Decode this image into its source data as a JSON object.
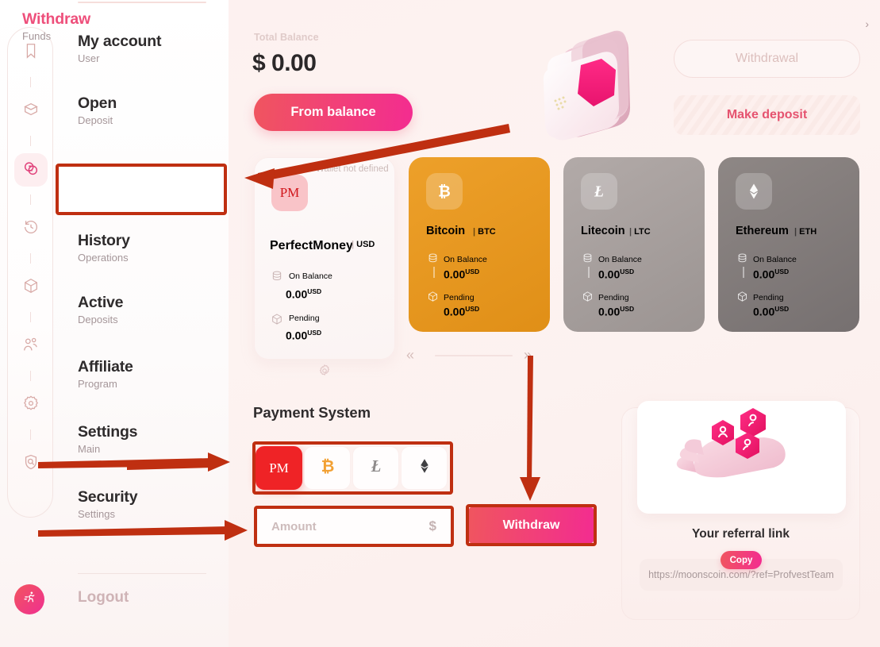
{
  "brand": {
    "accent": "#ee4f7b",
    "accent2": "#f32c90",
    "annotation": "#bf2f11"
  },
  "sidebar": {
    "items": [
      {
        "title": "My account",
        "sub": "User",
        "icon": "bookmark-icon"
      },
      {
        "title": "Open",
        "sub": "Deposit",
        "icon": "open-box-icon"
      },
      {
        "title": "Withdraw",
        "sub": "Funds",
        "icon": "exchange-icon",
        "chevron": "›"
      },
      {
        "title": "History",
        "sub": "Operations",
        "icon": "clock-history-icon"
      },
      {
        "title": "Active",
        "sub": "Deposits",
        "icon": "cube-icon"
      },
      {
        "title": "Affiliate",
        "sub": "Program",
        "icon": "users-icon"
      },
      {
        "title": "Settings",
        "sub": "Main",
        "icon": "gear-icon"
      },
      {
        "title": "Security",
        "sub": "Settings",
        "icon": "shield-search-icon"
      }
    ],
    "logout_label": "Logout",
    "logout_icon": "running-person-icon"
  },
  "header": {
    "total_balance_label": "Total Balance",
    "total_balance_value": "$ 0.00",
    "from_balance_label": "From balance",
    "withdrawal_label": "Withdrawal",
    "make_deposit_label": "Make deposit",
    "wallet_illustration": "wallet-3d-illustration"
  },
  "carousel": {
    "wallet_note": "Wallet not defined",
    "prev_icon": "chevron-double-left-icon",
    "next_icon": "chevron-double-right-icon",
    "settings_icon": "gear-icon",
    "on_balance_label": "On Balance",
    "pending_label": "Pending",
    "currency": "USD",
    "cards": [
      {
        "name": "PerfectMoney",
        "ticker": "USD",
        "badge": "PM",
        "on_balance": "0.00",
        "pending": "0.00",
        "unit": "USD"
      },
      {
        "name": "Bitcoin",
        "ticker": "BTC",
        "badge": "bitcoin-icon",
        "on_balance": "0.00",
        "pending": "0.00",
        "unit": "USD"
      },
      {
        "name": "Litecoin",
        "ticker": "LTC",
        "badge": "litecoin-icon",
        "on_balance": "0.00",
        "pending": "0.00",
        "unit": "USD"
      },
      {
        "name": "Ethereum",
        "ticker": "ETH",
        "badge": "ethereum-icon",
        "on_balance": "0.00",
        "pending": "0.00",
        "unit": "USD"
      }
    ]
  },
  "payment_system": {
    "title": "Payment System",
    "options": [
      {
        "label": "PM",
        "icon": "perfectmoney-icon",
        "selected": true
      },
      {
        "label": "BTC",
        "icon": "bitcoin-icon",
        "selected": false
      },
      {
        "label": "LTC",
        "icon": "litecoin-icon",
        "selected": false
      },
      {
        "label": "ETH",
        "icon": "ethereum-icon",
        "selected": false
      }
    ],
    "amount_placeholder": "Amount",
    "amount_value": "",
    "currency_symbol": "$",
    "withdraw_label": "Withdraw"
  },
  "referral": {
    "title": "Your referral link",
    "copy_label": "Copy",
    "link": "https://moonscoin.com/?ref=ProfvestTeam",
    "illustration": "hand-with-user-hexagons-illustration"
  },
  "annotations": {
    "arrow_to_card_label": "arrow-to-perfectmoney-card",
    "arrow_to_settings_label": "arrow-to-settings",
    "arrow_to_security_label": "arrow-to-security",
    "arrow_to_payment_system_label": "arrow-to-payment-system",
    "arrow_to_amount_label": "arrow-to-amount-field",
    "arrow_to_withdraw_label": "arrow-to-withdraw-button",
    "highlight_withdraw_nav": "highlight-withdraw-nav",
    "highlight_payment_system": "highlight-payment-options",
    "highlight_amount": "highlight-amount-field",
    "highlight_withdraw_button": "highlight-withdraw-button"
  }
}
